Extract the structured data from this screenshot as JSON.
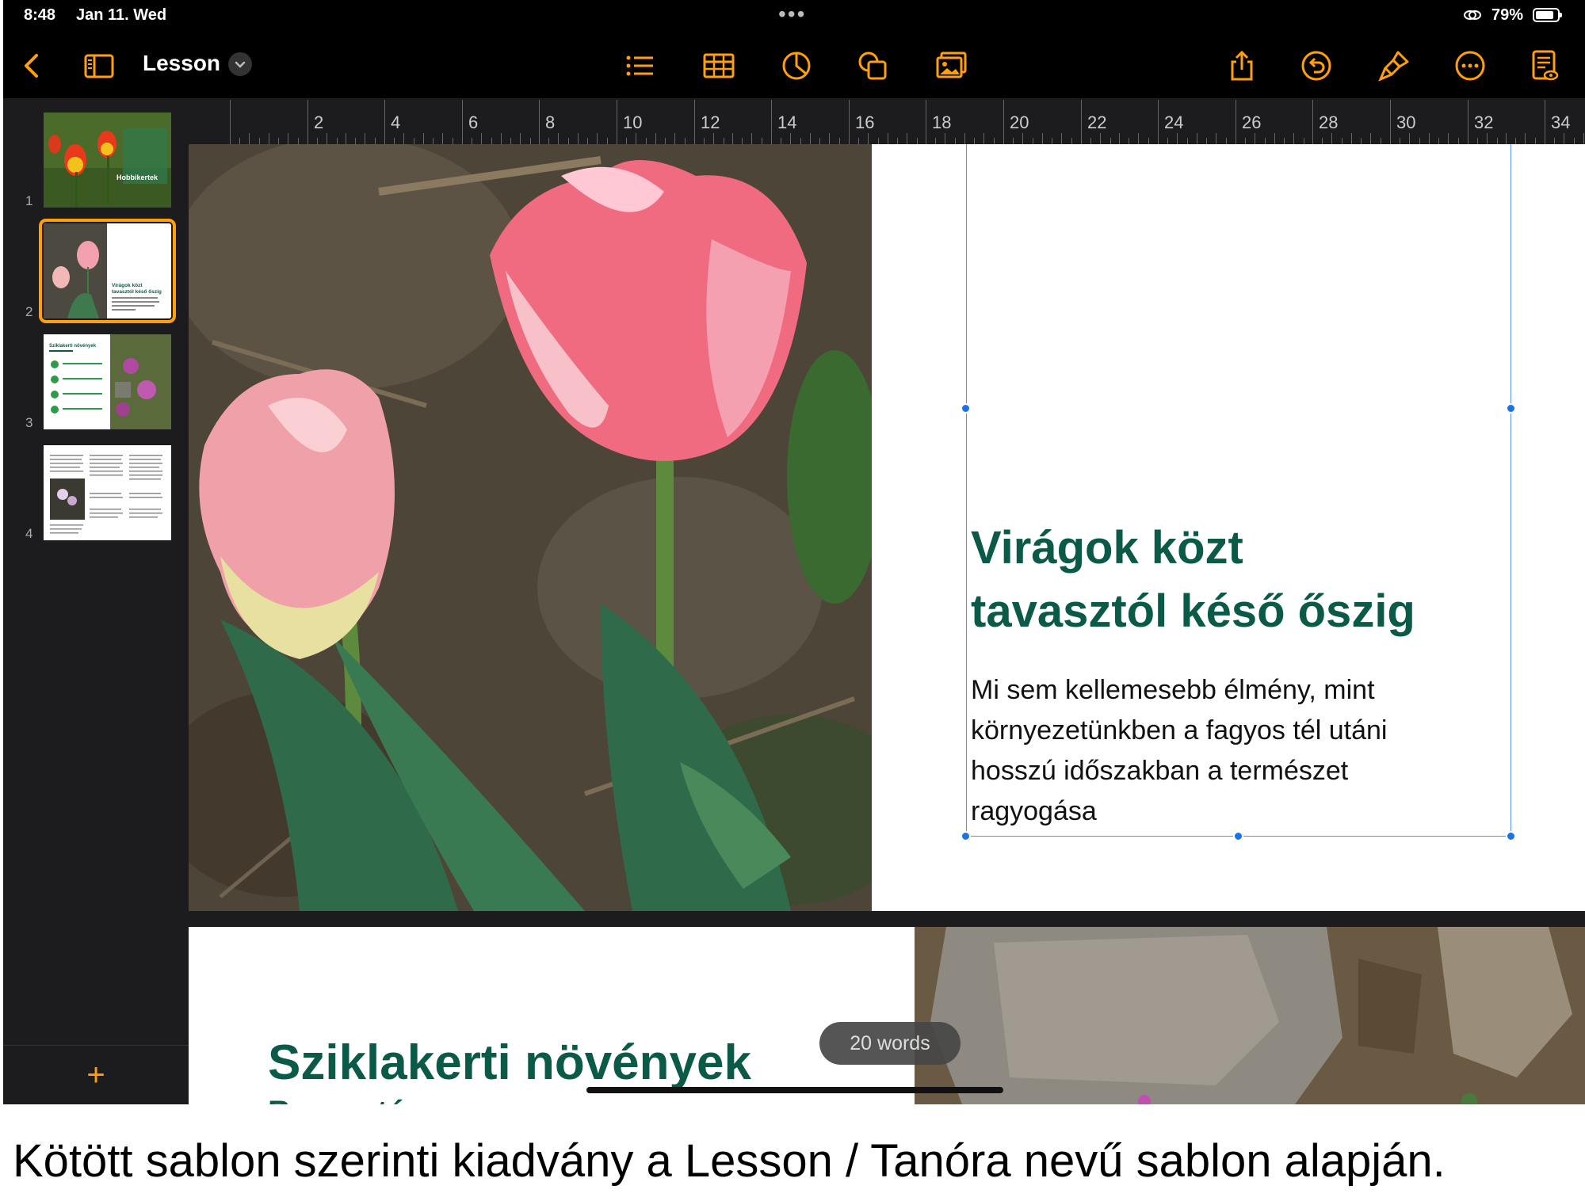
{
  "status_bar": {
    "time": "8:48",
    "date": "Jan 11. Wed",
    "battery": "79%"
  },
  "toolbar": {
    "document_title": "Lesson",
    "icons": [
      "back-chevron-icon",
      "sidebar-icon",
      "list-icon",
      "table-icon",
      "chart-icon",
      "shape-icon",
      "media-icon",
      "share-icon",
      "undo-icon",
      "format-brush-icon",
      "more-icon",
      "document-view-icon"
    ]
  },
  "ruler": {
    "labels": [
      "2",
      "4",
      "6",
      "8",
      "10",
      "12",
      "14",
      "16",
      "18",
      "20",
      "22",
      "24",
      "26",
      "28",
      "30",
      "32",
      "34"
    ]
  },
  "thumbnails": [
    {
      "number": "1",
      "banner": "Hobbikertek"
    },
    {
      "number": "2",
      "title_lines": [
        "Virágok közt",
        "tavasztól késő őszig"
      ]
    },
    {
      "number": "3",
      "title": "Sziklakerti növények"
    },
    {
      "number": "4"
    }
  ],
  "page1": {
    "heading_lines": [
      "Virágok közt",
      "tavasztól késő őszig"
    ],
    "body_lines": [
      "Mi sem kellemesebb élmény, mint",
      "környezetünkben a fagyos tél utáni",
      "hosszú időszakban a természet",
      "ragyogása"
    ]
  },
  "page2": {
    "heading": "Sziklakerti növények",
    "subheading": "Bevezetés"
  },
  "word_count": "20 words",
  "sidebar": {
    "add_label": "+"
  },
  "caption": "Kötött sablon szerinti kiadvány a Lesson / Tanóra nevű sablon alapján.",
  "colors": {
    "accent": "#ff9f0a",
    "heading_green": "#0b5a48",
    "selection_blue": "#1a73e8"
  }
}
